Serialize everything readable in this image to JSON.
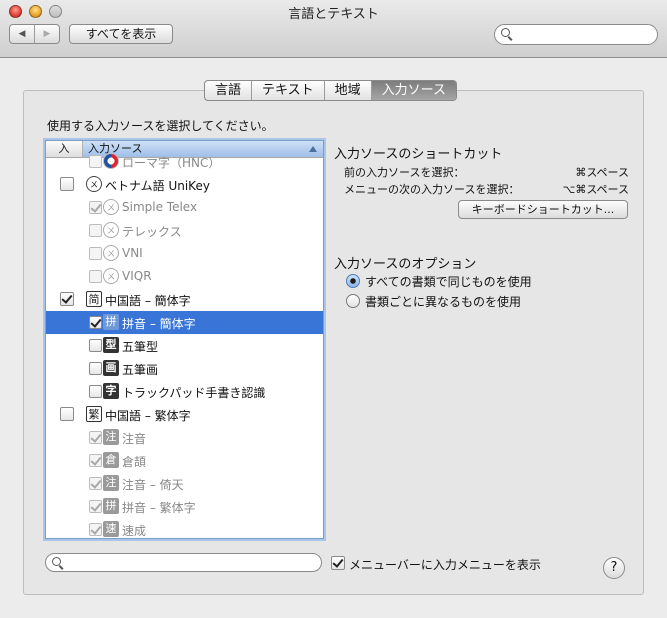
{
  "window": {
    "title": "言語とテキスト"
  },
  "toolbar": {
    "back_icon": "◀",
    "forward_icon": "▶",
    "show_all": "すべてを表示",
    "search_placeholder": ""
  },
  "tabs": [
    {
      "label": "言語",
      "active": false
    },
    {
      "label": "テキスト",
      "active": false
    },
    {
      "label": "地域",
      "active": false
    },
    {
      "label": "入力ソース",
      "active": true
    }
  ],
  "instruction": "使用する入力ソースを選択してください。",
  "list": {
    "header_col1": "入",
    "header_col2": "入力ソース",
    "rows": [
      {
        "label": "ローマ字（HNC）",
        "icon": "korean-flag-icon",
        "icon_text": "",
        "checked": false,
        "indent": true,
        "dim": true,
        "selected": false
      },
      {
        "label": "ベトナム語 UniKey",
        "icon": "vietnamese-icon",
        "icon_text": "ㄨ",
        "checked": false,
        "indent": false,
        "dim": false,
        "selected": false
      },
      {
        "label": "Simple Telex",
        "icon": "vietnamese-icon",
        "icon_text": "ㄨ",
        "checked": true,
        "indent": true,
        "dim": true,
        "selected": false
      },
      {
        "label": "テレックス",
        "icon": "vietnamese-icon",
        "icon_text": "ㄨ",
        "checked": false,
        "indent": true,
        "dim": true,
        "selected": false
      },
      {
        "label": "VNI",
        "icon": "vietnamese-icon",
        "icon_text": "ㄨ",
        "checked": false,
        "indent": true,
        "dim": true,
        "selected": false
      },
      {
        "label": "VIQR",
        "icon": "vietnamese-icon",
        "icon_text": "ㄨ",
        "checked": false,
        "indent": true,
        "dim": true,
        "selected": false
      },
      {
        "label": "中国語 – 簡体字",
        "icon": "simplified-chinese-icon",
        "icon_text": "简",
        "checked": true,
        "indent": false,
        "dim": false,
        "selected": false
      },
      {
        "label": "拼音 – 簡体字",
        "icon": "pinyin-icon",
        "icon_text": "拼",
        "checked": true,
        "indent": true,
        "dim": false,
        "selected": true
      },
      {
        "label": "五筆型",
        "icon": "wubi-xing-icon",
        "icon_text": "型",
        "checked": false,
        "indent": true,
        "dim": false,
        "selected": false
      },
      {
        "label": "五筆画",
        "icon": "wubi-hua-icon",
        "icon_text": "画",
        "checked": false,
        "indent": true,
        "dim": false,
        "selected": false
      },
      {
        "label": "トラックパッド手書き認識",
        "icon": "handwriting-icon",
        "icon_text": "字",
        "checked": false,
        "indent": true,
        "dim": false,
        "selected": false
      },
      {
        "label": "中国語 – 繁体字",
        "icon": "traditional-chinese-icon",
        "icon_text": "繁",
        "checked": false,
        "indent": false,
        "dim": false,
        "selected": false
      },
      {
        "label": "注音",
        "icon": "zhuyin-icon",
        "icon_text": "注",
        "checked": true,
        "indent": true,
        "dim": true,
        "selected": false
      },
      {
        "label": "倉頡",
        "icon": "cangjie-icon",
        "icon_text": "倉",
        "checked": true,
        "indent": true,
        "dim": true,
        "selected": false
      },
      {
        "label": "注音 – 倚天",
        "icon": "zhuyin-eten-icon",
        "icon_text": "注",
        "checked": true,
        "indent": true,
        "dim": true,
        "selected": false
      },
      {
        "label": "拼音 – 繁体字",
        "icon": "pinyin-icon",
        "icon_text": "拼",
        "checked": true,
        "indent": true,
        "dim": true,
        "selected": false
      },
      {
        "label": "速成",
        "icon": "sucheng-icon",
        "icon_text": "速",
        "checked": true,
        "indent": true,
        "dim": true,
        "selected": false
      }
    ]
  },
  "shortcuts": {
    "title": "入力ソースのショートカット",
    "prev_label": "前の入力ソースを選択：",
    "prev_key": "⌘スペース",
    "next_label": "メニューの次の入力ソースを選択：",
    "next_key": "⌥⌘スペース",
    "button": "キーボードショートカット..."
  },
  "options": {
    "title": "入力ソースのオプション",
    "radio1": "すべての書類で同じものを使用",
    "radio2": "書類ごとに異なるものを使用",
    "selected": 1
  },
  "bottom": {
    "search_placeholder": "",
    "menu_checkbox_label": "メニューバーに入力メニューを表示",
    "menu_checkbox_checked": true,
    "help_label": "?"
  }
}
